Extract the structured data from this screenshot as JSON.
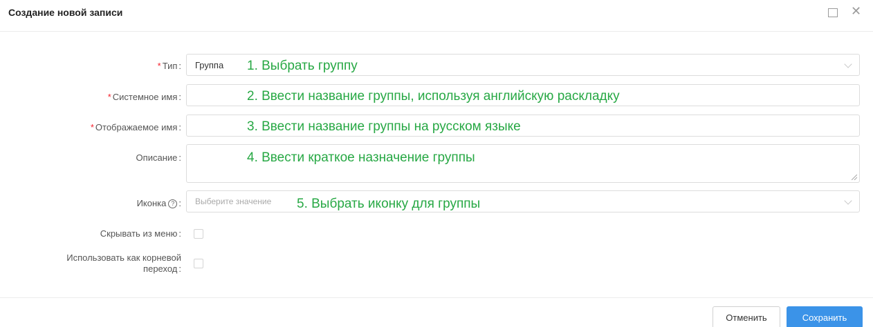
{
  "dialog": {
    "title": "Создание новой записи"
  },
  "form": {
    "type": {
      "label": "Тип",
      "required": "*",
      "value": "Группа",
      "hint": "1. Выбрать группу"
    },
    "system_name": {
      "label": "Системное имя",
      "required": "*",
      "value": "",
      "hint": "2. Ввести название группы, используя английскую раскладку"
    },
    "display_name": {
      "label": "Отображаемое имя",
      "required": "*",
      "value": "",
      "hint": "3. Ввести название группы на русском языке"
    },
    "description": {
      "label": "Описание",
      "value": "",
      "hint": "4. Ввести краткое назначение группы"
    },
    "icon": {
      "label": "Иконка",
      "help": "?",
      "placeholder": "Выберите значение",
      "hint": "5. Выбрать иконку для группы"
    },
    "hide_from_menu": {
      "label": "Скрывать из меню",
      "checked": false
    },
    "root_transition": {
      "label_line1": "Использовать как корневой",
      "label_line2": "переход",
      "checked": false
    },
    "colon": ":"
  },
  "footer": {
    "cancel_label": "Отменить",
    "save_label": "Сохранить"
  },
  "colors": {
    "hint_green": "#27a844",
    "primary_blue": "#3b93e8",
    "required_red": "#f5222d"
  }
}
